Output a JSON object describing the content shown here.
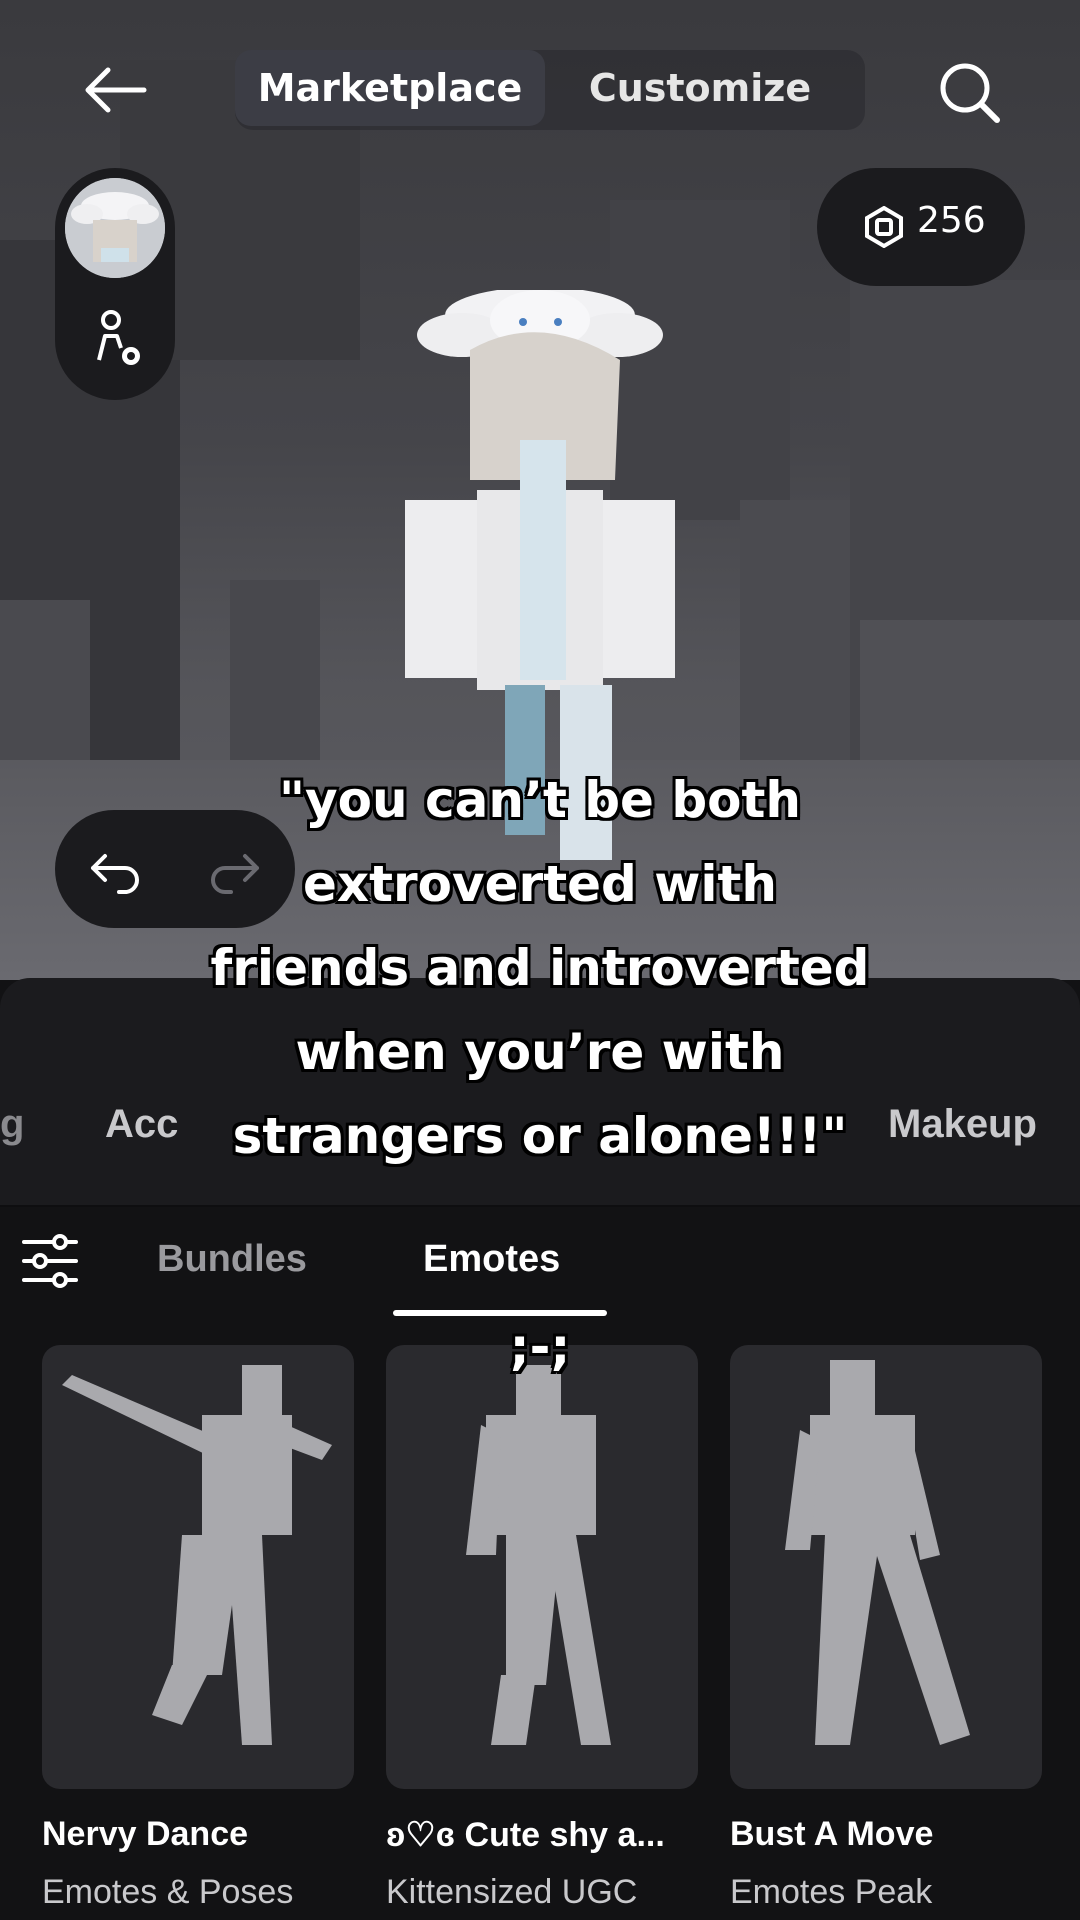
{
  "header": {
    "tabs": [
      {
        "label": "Marketplace",
        "active": true
      },
      {
        "label": "Customize",
        "active": false
      }
    ],
    "back_icon": "arrow-left-icon",
    "search_icon": "search-icon"
  },
  "currency": {
    "icon": "robux-icon",
    "amount": "256"
  },
  "avatar_controls": {
    "icons": [
      "avatar-headshot",
      "avatar-settings-icon"
    ]
  },
  "history": {
    "icons": [
      "undo-icon",
      "redo-icon"
    ]
  },
  "categories": [
    "g",
    "Acc",
    "Makeup"
  ],
  "subtabs": [
    {
      "label": "Bundles",
      "active": false
    },
    {
      "label": "Emotes",
      "active": true
    }
  ],
  "items": [
    {
      "title": "Nervy Dance",
      "creator": "Emotes & Poses"
    },
    {
      "title": "ʚ♡ɞ Cute shy a...",
      "creator": "Kittensized UGC"
    },
    {
      "title": "Bust A Move",
      "creator": "Emotes Peak"
    }
  ],
  "overlay": {
    "caption_lines": [
      "\"you can’t be both",
      "extroverted with",
      "friends and introverted",
      "when you’re with",
      "strangers or alone!!!\""
    ],
    "emoticon": ";-;"
  },
  "colors": {
    "panel": "#1b1b1e",
    "background": "#121214",
    "thumb": "#2a2a2e",
    "active_tab": "#3c3d45"
  }
}
